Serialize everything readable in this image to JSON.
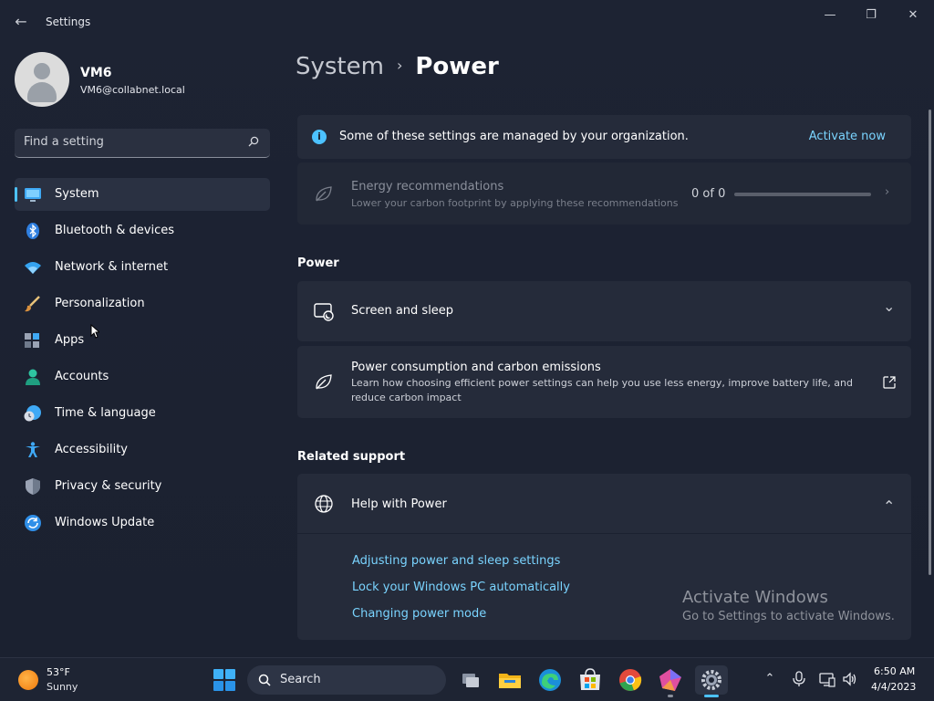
{
  "window": {
    "title": "Settings",
    "back_glyph": "←",
    "minimize_glyph": "—",
    "maximize_glyph": "❐",
    "close_glyph": "✕"
  },
  "profile": {
    "name": "VM6",
    "email": "VM6@collabnet.local"
  },
  "search": {
    "placeholder": "Find a setting"
  },
  "sidebar": {
    "items": [
      {
        "label": "System",
        "icon": "monitor-icon",
        "active": true
      },
      {
        "label": "Bluetooth & devices",
        "icon": "bluetooth-icon"
      },
      {
        "label": "Network & internet",
        "icon": "wifi-icon"
      },
      {
        "label": "Personalization",
        "icon": "brush-icon"
      },
      {
        "label": "Apps",
        "icon": "apps-icon"
      },
      {
        "label": "Accounts",
        "icon": "person-icon"
      },
      {
        "label": "Time & language",
        "icon": "clock-globe-icon"
      },
      {
        "label": "Accessibility",
        "icon": "accessibility-icon"
      },
      {
        "label": "Privacy & security",
        "icon": "shield-icon"
      },
      {
        "label": "Windows Update",
        "icon": "update-icon"
      }
    ]
  },
  "breadcrumb": {
    "parent": "System",
    "separator": "›",
    "current": "Power"
  },
  "managed_banner": {
    "text": "Some of these settings are managed by your organization.",
    "action": "Activate now",
    "info_glyph": "i"
  },
  "energy": {
    "title": "Energy recommendations",
    "subtitle": "Lower your carbon footprint by applying these recommendations",
    "count": "0 of 0",
    "progress": 0,
    "chevron": "›"
  },
  "power_section": {
    "title": "Power",
    "screen_sleep": {
      "label": "Screen and sleep",
      "chevron": "⌄"
    },
    "consumption": {
      "title": "Power consumption and carbon emissions",
      "subtitle_line1": "Learn how choosing efficient power settings can help you use less energy, improve battery life, and",
      "subtitle_line2": "reduce carbon impact"
    }
  },
  "related": {
    "title": "Related support",
    "help": {
      "label": "Help with Power",
      "chevron": "⌃",
      "links": [
        "Adjusting power and sleep settings",
        "Lock your Windows PC automatically",
        "Changing power mode"
      ]
    }
  },
  "watermark": {
    "line1": "Activate Windows",
    "line2": "Go to Settings to activate Windows."
  },
  "taskbar": {
    "weather_temp": "53°F",
    "weather_cond": "Sunny",
    "search_label": "Search",
    "apps": [
      "task-view-icon",
      "file-explorer-icon",
      "edge-icon",
      "store-icon",
      "chrome-icon",
      "copilot-icon",
      "settings-icon"
    ],
    "time": "6:50 AM",
    "date": "4/4/2023",
    "tray_up_glyph": "⌃",
    "colors": {
      "accent": "#4cc2ff",
      "link": "#7ad4ff"
    }
  }
}
